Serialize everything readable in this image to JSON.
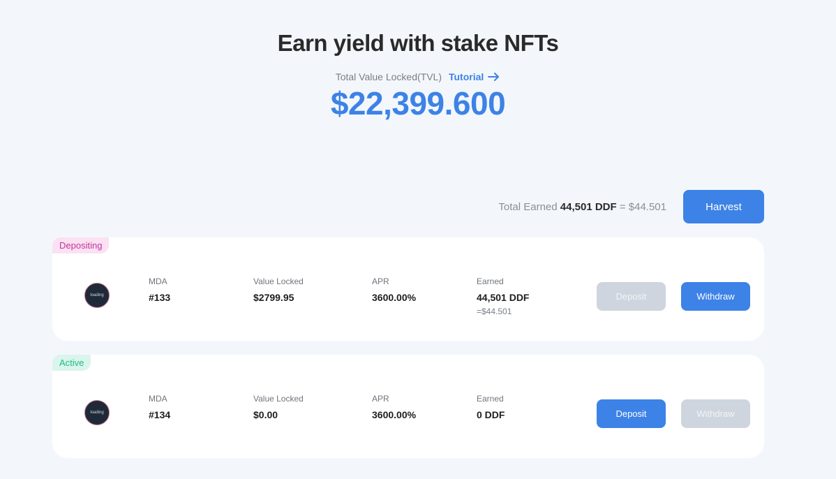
{
  "header": {
    "title": "Earn yield with stake NFTs",
    "tvl_label": "Total Value Locked(TVL)",
    "tutorial_label": "Tutorial",
    "tvl_value": "$22,399.600"
  },
  "summary": {
    "earned_prefix": "Total Earned",
    "earned_amount": "44,501 DDF",
    "earned_usd": "= $44.501",
    "harvest_label": "Harvest"
  },
  "pools": [
    {
      "status": "Depositing",
      "avatar_text": "loading",
      "collection_label": "MDA",
      "token_id": "#133",
      "value_locked_label": "Value Locked",
      "value_locked": "$2799.95",
      "apr_label": "APR",
      "apr": "3600.00%",
      "earned_label": "Earned",
      "earned": "44,501 DDF",
      "earned_usd": "=$44.501",
      "deposit_label": "Deposit",
      "withdraw_label": "Withdraw",
      "deposit_enabled": false,
      "withdraw_enabled": true
    },
    {
      "status": "Active",
      "avatar_text": "loading",
      "collection_label": "MDA",
      "token_id": "#134",
      "value_locked_label": "Value Locked",
      "value_locked": "$0.00",
      "apr_label": "APR",
      "apr": "3600.00%",
      "earned_label": "Earned",
      "earned": "0 DDF",
      "earned_usd": "",
      "deposit_label": "Deposit",
      "withdraw_label": "Withdraw",
      "deposit_enabled": true,
      "withdraw_enabled": false
    }
  ],
  "colors": {
    "accent": "#3d82e6",
    "background": "#f3f7fc",
    "depositing_badge": "#c0349c",
    "active_badge": "#1fb988"
  }
}
